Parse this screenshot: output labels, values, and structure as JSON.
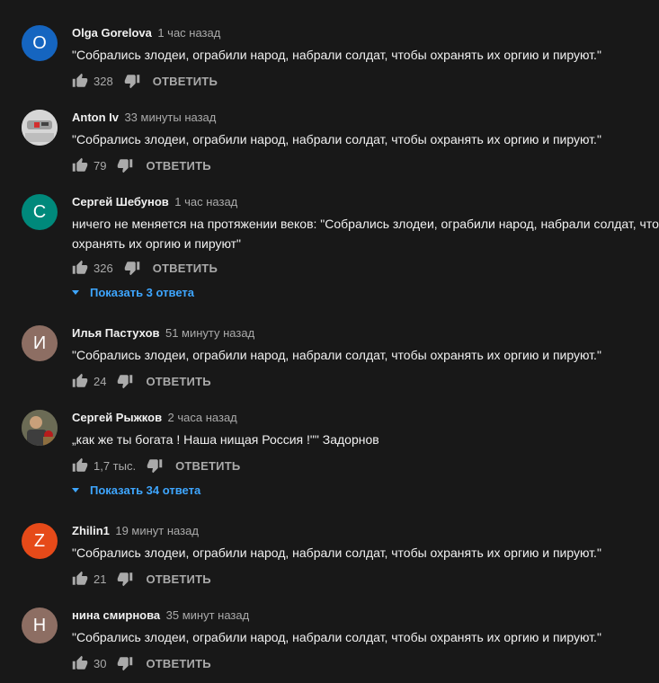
{
  "labels": {
    "reply": "ОТВЕТИТЬ"
  },
  "colors": {
    "background": "#181818",
    "link": "#3ea6ff"
  },
  "comments": [
    {
      "author": "Olga Gorelova",
      "time": "1 час назад",
      "avatar_letter": "O",
      "avatar_color": "#1565c0",
      "text": "\"Собрались злодеи, ограбили народ, набрали солдат, чтобы охранять их оргию и пируют.\"",
      "likes": "328"
    },
    {
      "author": "Anton Iv",
      "time": "33 минуты назад",
      "avatar_letter": "",
      "avatar_color": "#cfcfcf",
      "text": "\"Собрались злодеи, ограбили народ, набрали солдат, чтобы охранять их оргию и пируют.\"",
      "likes": "79"
    },
    {
      "author": "Сергей Шебунов",
      "time": "1 час назад",
      "avatar_letter": "С",
      "avatar_color": "#00897b",
      "text": "ничего не меняется на протяжении веков: \"Собрались злодеи, ограбили народ, набрали солдат, что\nохранять их оргию и пируют\"",
      "likes": "326",
      "replies_label": "Показать 3 ответа"
    },
    {
      "author": "Илья Пастухов",
      "time": "51 минуту назад",
      "avatar_letter": "И",
      "avatar_color": "#8d6e63",
      "text": "\"Собрались злодеи, ограбили народ, набрали солдат, чтобы охранять их оргию и пируют.\"",
      "likes": "24"
    },
    {
      "author": "Сергей Рыжков",
      "time": "2 часа назад",
      "avatar_letter": "",
      "avatar_color": "#5d5d4a",
      "text": "„как же ты богата ! Наша нищая Россия !\"\" Задорнов",
      "likes": "1,7 тыс.",
      "replies_label": "Показать 34 ответа"
    },
    {
      "author": "Zhilin1",
      "time": "19 минут назад",
      "avatar_letter": "Z",
      "avatar_color": "#e64a19",
      "text": "\"Собрались злодеи, ограбили народ, набрали солдат, чтобы охранять их оргию и пируют.\"",
      "likes": "21"
    },
    {
      "author": "нина смирнова",
      "time": "35 минут назад",
      "avatar_letter": "Н",
      "avatar_color": "#8d6e63",
      "text": "\"Собрались злодеи, ограбили народ, набрали солдат, чтобы охранять их оргию и пируют.\"",
      "likes": "30"
    }
  ]
}
